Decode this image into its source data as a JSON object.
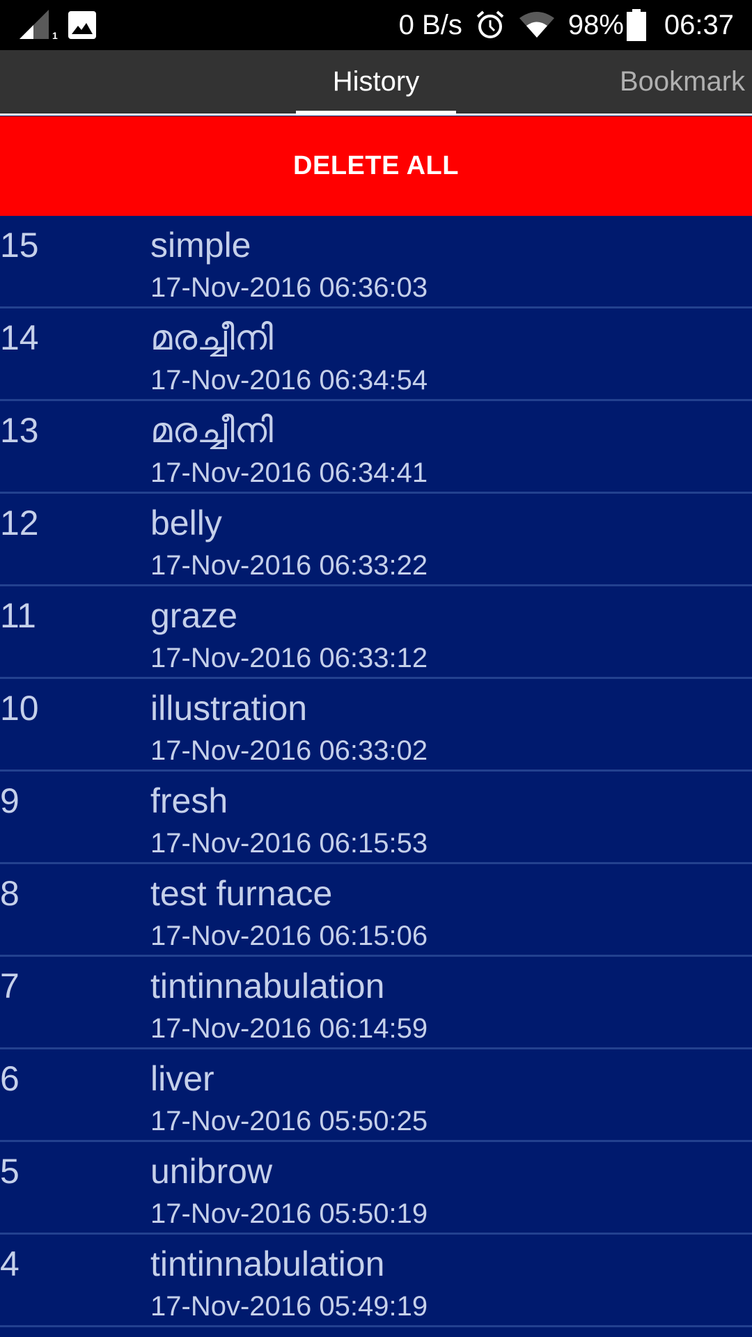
{
  "status_bar": {
    "icons_left": [
      "signal-icon",
      "image-icon"
    ],
    "sim_slot": "1",
    "network_speed": "0 B/s",
    "alarm_icon": "alarm-icon",
    "wifi_icon": "wifi-icon",
    "battery_percent": "98%",
    "battery_icon": "battery-icon",
    "time": "06:37"
  },
  "tabs": [
    {
      "label": "History",
      "selected": true
    },
    {
      "label": "Bookmark",
      "selected": false
    }
  ],
  "delete_all_label": "DELETE ALL",
  "colors": {
    "tab_bar_bg": "#333333",
    "delete_bg": "#ff0000",
    "list_bg": "#001a6e",
    "divider": "#23418f",
    "text": "#c5d0ea"
  },
  "history": [
    {
      "num": "15",
      "word": "simple",
      "time": "17-Nov-2016 06:36:03"
    },
    {
      "num": "14",
      "word": "മരച്ചീനി",
      "time": "17-Nov-2016 06:34:54"
    },
    {
      "num": "13",
      "word": "മരച്ചീനി",
      "time": "17-Nov-2016 06:34:41"
    },
    {
      "num": "12",
      "word": "belly",
      "time": "17-Nov-2016 06:33:22"
    },
    {
      "num": "11",
      "word": "graze",
      "time": "17-Nov-2016 06:33:12"
    },
    {
      "num": "10",
      "word": "illustration",
      "time": "17-Nov-2016 06:33:02"
    },
    {
      "num": "9",
      "word": "fresh",
      "time": "17-Nov-2016 06:15:53"
    },
    {
      "num": "8",
      "word": "test furnace",
      "time": "17-Nov-2016 06:15:06"
    },
    {
      "num": "7",
      "word": "tintinnabulation",
      "time": "17-Nov-2016 06:14:59"
    },
    {
      "num": "6",
      "word": "liver",
      "time": "17-Nov-2016 05:50:25"
    },
    {
      "num": "5",
      "word": "unibrow",
      "time": "17-Nov-2016 05:50:19"
    },
    {
      "num": "4",
      "word": "tintinnabulation",
      "time": "17-Nov-2016 05:49:19"
    }
  ]
}
